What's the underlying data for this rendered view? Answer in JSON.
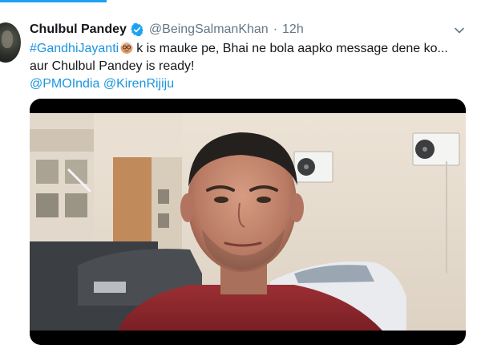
{
  "tweet": {
    "author_name": "Chulbul Pandey",
    "verified": true,
    "handle": "@BeingSalmanKhan",
    "separator": "·",
    "time": "12h",
    "hashtag": "#GandhiJayanti",
    "emoji": "gandhi-emoji",
    "line1_text": "k is mauke pe, Bhai ne bola aapko message dene ko...",
    "line2_text": "aur Chulbul Pandey is ready!",
    "mentions": [
      "@PMOIndia",
      "@KirenRijiju"
    ]
  },
  "media": {
    "type": "video"
  },
  "colors": {
    "link": "#1b95e0",
    "verified": "#1da1f2",
    "muted": "#657786",
    "text": "#14171a",
    "accent_tab": "#1da1f2"
  }
}
